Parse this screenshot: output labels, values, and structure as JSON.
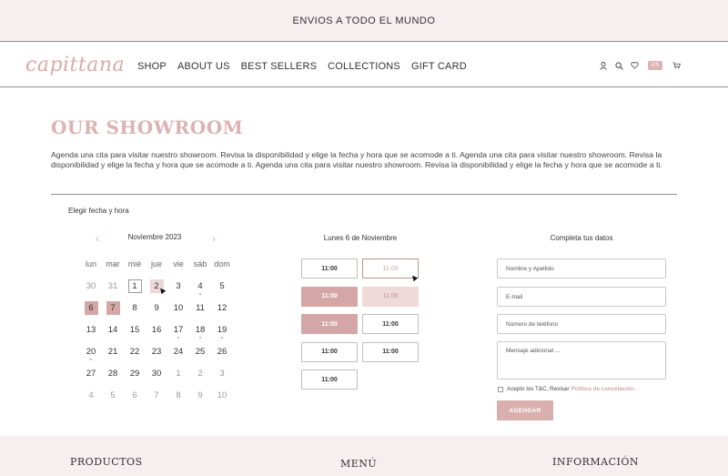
{
  "announcement": "ENVIOS A TODO EL MUNDO",
  "brand": "capittana",
  "nav": [
    "SHOP",
    "ABOUT US",
    "BEST SELLERS",
    "COLLECTIONS",
    "GIFT CARD"
  ],
  "header_icons": [
    "user-icon",
    "search-icon",
    "heart-icon",
    "cart-icon"
  ],
  "language": "ES",
  "page": {
    "title": "OUR SHOWROOM",
    "intro": "Agenda una cita para visitar nuestro showroom. Revisa la disponibilidad y elige la fecha y hora que se acomode a ti. Agenda una cita para visitar nuestro showroom. Revisa la disponibilidad y elige la fecha y hora que se acomode a ti. Agenda una cita para visitar nuestro showroom. Revisa la disponibilidad y elige la fecha y hora que se acomode a ti.",
    "pick_label": "Elegir fecha y hora"
  },
  "calendar": {
    "month": "Noviembre 2023",
    "weekdays": [
      "lun",
      "mar",
      "mié",
      "jue",
      "vie",
      "sáb",
      "dom"
    ],
    "weeks": [
      [
        {
          "d": "30",
          "m": 1
        },
        {
          "d": "31",
          "m": 1
        },
        {
          "d": "1",
          "today": 1
        },
        {
          "d": "2",
          "hover": 1
        },
        {
          "d": "3"
        },
        {
          "d": "4",
          "dot": 1
        },
        {
          "d": "5"
        }
      ],
      [
        {
          "d": "6",
          "sel": 1
        },
        {
          "d": "7",
          "sel": 1
        },
        {
          "d": "8"
        },
        {
          "d": "9"
        },
        {
          "d": "10"
        },
        {
          "d": "11"
        },
        {
          "d": "12"
        }
      ],
      [
        {
          "d": "13"
        },
        {
          "d": "14"
        },
        {
          "d": "15"
        },
        {
          "d": "16"
        },
        {
          "d": "17",
          "dot": 1
        },
        {
          "d": "18",
          "dot": 1
        },
        {
          "d": "19",
          "dot": 1
        }
      ],
      [
        {
          "d": "20",
          "dot": 1
        },
        {
          "d": "21"
        },
        {
          "d": "22"
        },
        {
          "d": "23"
        },
        {
          "d": "24"
        },
        {
          "d": "25"
        },
        {
          "d": "26"
        }
      ],
      [
        {
          "d": "27"
        },
        {
          "d": "28"
        },
        {
          "d": "29"
        },
        {
          "d": "30"
        },
        {
          "d": "1",
          "m": 1
        },
        {
          "d": "2",
          "m": 1
        },
        {
          "d": "3",
          "m": 1
        }
      ],
      [
        {
          "d": "4",
          "m": 1
        },
        {
          "d": "5",
          "m": 1
        },
        {
          "d": "6",
          "m": 1
        },
        {
          "d": "7",
          "m": 1
        },
        {
          "d": "8",
          "m": 1
        },
        {
          "d": "9",
          "m": 1
        },
        {
          "d": "10",
          "m": 1
        }
      ]
    ]
  },
  "slots": {
    "title": "Lunes 6 de Noviembre",
    "items": [
      {
        "time": "11:00",
        "state": "available"
      },
      {
        "time": "11:00",
        "state": "focus"
      },
      {
        "time": "11:00",
        "state": "booked"
      },
      {
        "time": "11:00",
        "state": "pending"
      },
      {
        "time": "11:00",
        "state": "booked"
      },
      {
        "time": "11:00",
        "state": "available"
      },
      {
        "time": "11:00",
        "state": "available"
      },
      {
        "time": "11:00",
        "state": "available"
      },
      {
        "time": "11:00",
        "state": "available"
      }
    ]
  },
  "form": {
    "title": "Completa tus datos",
    "name_placeholder": "Nombre y Apellido",
    "email_placeholder": "E-mail",
    "phone_placeholder": "Número de teléfono",
    "message_placeholder": "Mensaje adicional ...",
    "terms_text": "Acepto los T&C. Revisar",
    "terms_link": "Política de cancelación.",
    "submit": "AGENDAR"
  },
  "footer": {
    "products": "PRODUCTOS",
    "menu": "MENÚ",
    "info": "INFORMACIÓN"
  }
}
